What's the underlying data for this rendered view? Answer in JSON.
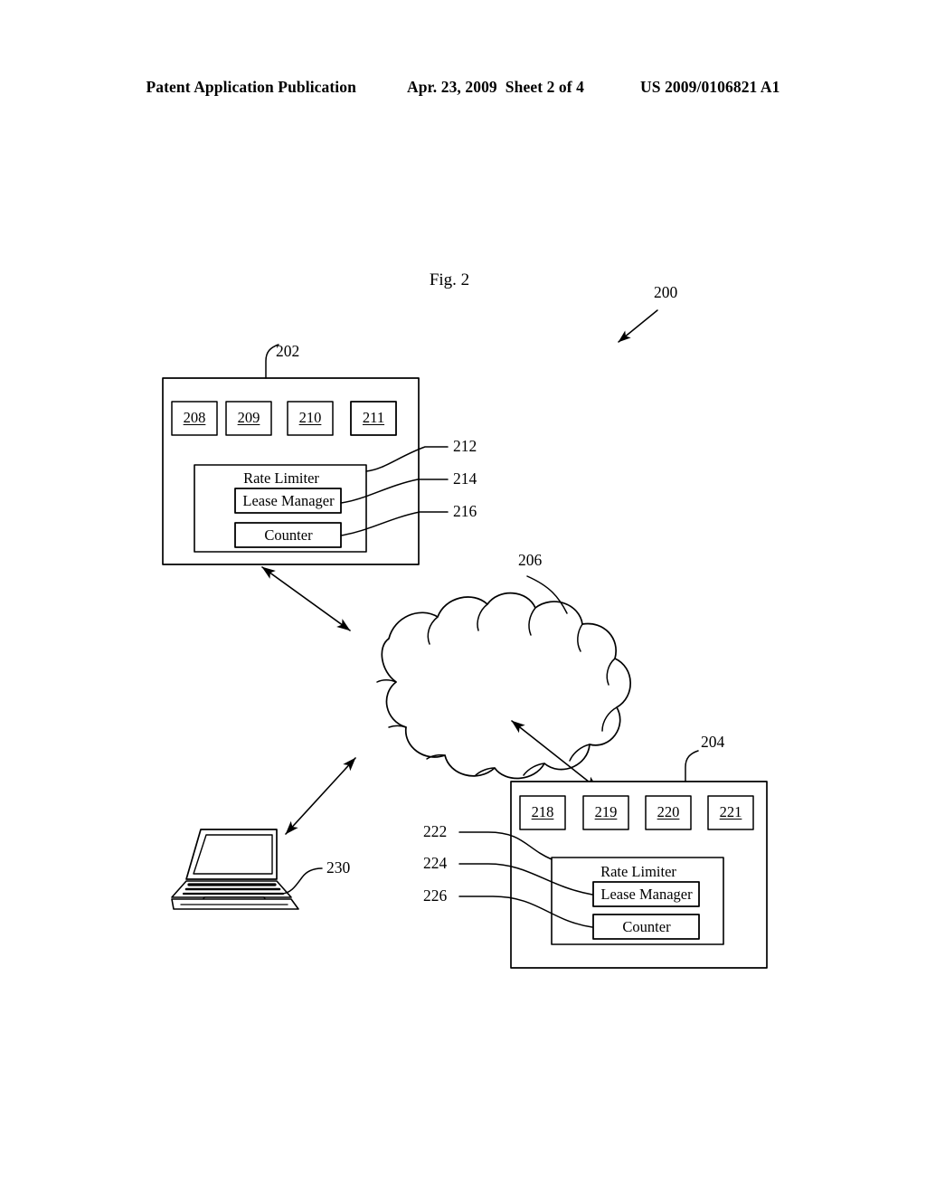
{
  "header": {
    "publication": "Patent Application Publication",
    "date": "Apr. 23, 2009",
    "sheet": "Sheet 2 of 4",
    "patent_number": "US 2009/0106821 A1"
  },
  "figure": {
    "title": "Fig. 2",
    "system_ref": "200",
    "line_color": "#000000",
    "background": "#ffffff"
  },
  "server_a": {
    "ref": "202",
    "units": [
      "208",
      "209",
      "210",
      "211"
    ],
    "rate_limiter": {
      "ref": "212",
      "label": "Rate Limiter",
      "lease_manager": {
        "ref": "214",
        "label": "Lease Manager"
      },
      "counter": {
        "ref": "216",
        "label": "Counter"
      }
    }
  },
  "server_b": {
    "ref": "204",
    "units": [
      "218",
      "219",
      "220",
      "221"
    ],
    "rate_limiter": {
      "ref": "222",
      "label": "Rate Limiter",
      "lease_manager": {
        "ref": "224",
        "label": "Lease Manager"
      },
      "counter": {
        "ref": "226",
        "label": "Counter"
      }
    }
  },
  "network": {
    "ref": "206",
    "icon": "cloud-icon"
  },
  "client": {
    "ref": "230",
    "icon": "laptop-icon"
  }
}
